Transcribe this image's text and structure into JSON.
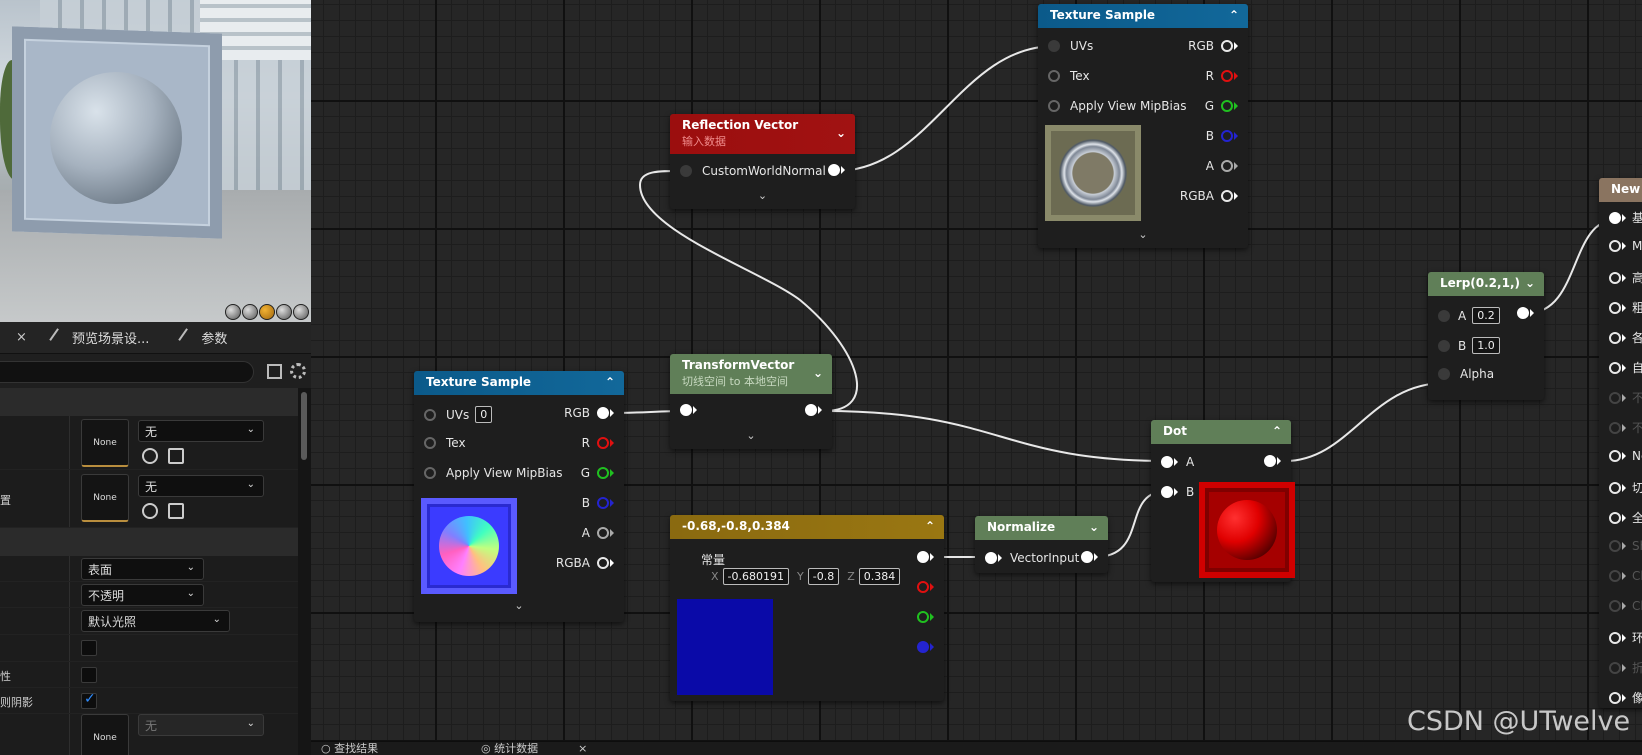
{
  "left_panel": {
    "tabs": {
      "close_glyph": "×",
      "preview_scene": "预览场景设...",
      "params": "参数"
    },
    "slots": {
      "none": "None"
    },
    "combos": {
      "tex1": "无",
      "tex2": "无",
      "domain": "表面",
      "blend": "不透明",
      "shading": "默认光照",
      "tex3": "无"
    },
    "partial_labels": {
      "row2": "置",
      "row_prop": "性",
      "row_shadow": "则阴影"
    },
    "checkboxes": {
      "a": false,
      "b": false,
      "c": true
    }
  },
  "nodes": {
    "tex_top": {
      "title": "Texture Sample",
      "inputs": [
        "UVs",
        "Tex",
        "Apply View MipBias"
      ],
      "outputs": [
        "RGB",
        "R",
        "G",
        "B",
        "A",
        "RGBA"
      ]
    },
    "reflection": {
      "title": "Reflection Vector",
      "subtitle": "输入数据",
      "pin": "CustomWorldNormal"
    },
    "tex_left": {
      "title": "Texture Sample",
      "inputs": [
        "UVs",
        "Tex",
        "Apply View MipBias"
      ],
      "uv_value": "0",
      "outputs": [
        "RGB",
        "R",
        "G",
        "B",
        "A",
        "RGBA"
      ]
    },
    "transform": {
      "title": "TransformVector",
      "subtitle": "切线空间 to 本地空间"
    },
    "constant": {
      "title": "-0.68,-0.8,0.384",
      "label": "常量",
      "x_label": "X",
      "x": "-0.680191",
      "y_label": "Y",
      "y": "-0.8",
      "z_label": "Z",
      "z": "0.384",
      "swatch": "#0a0aa8"
    },
    "normalize": {
      "title": "Normalize",
      "pin": "VectorInput"
    },
    "dot": {
      "title": "Dot",
      "a": "A",
      "b": "B"
    },
    "lerp": {
      "title": "Lerp(0.2,1,)",
      "a": "A",
      "a_val": "0.2",
      "b": "B",
      "b_val": "1.0",
      "alpha": "Alpha"
    },
    "result": {
      "title": "New",
      "pins": [
        "基",
        "M",
        "高",
        "粗",
        "各",
        "自",
        "不",
        "不",
        "Ne",
        "切",
        "全",
        "Sh",
        "Cl",
        "Cl",
        "环",
        "折",
        "像"
      ]
    }
  },
  "bottom": {
    "find_results": "查找结果",
    "stats": "统计数据"
  },
  "watermark": "CSDN @UTwelve"
}
